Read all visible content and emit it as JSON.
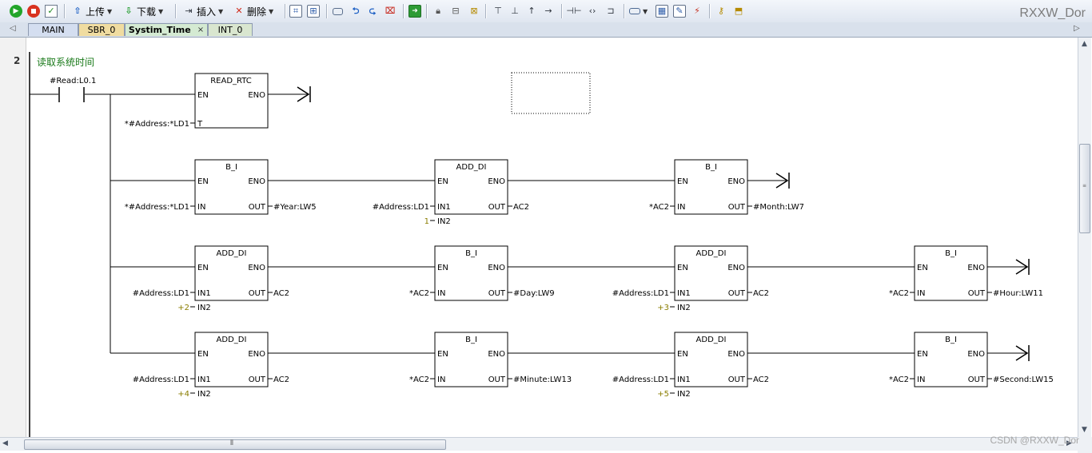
{
  "toolbar": {
    "upload_label": "上传",
    "download_label": "下载",
    "insert_label": "插入",
    "delete_label": "删除",
    "icons": [
      "run-icon",
      "stop-icon",
      "compile-icon",
      "upload-icon",
      "download-icon",
      "insert-icon",
      "delete-icon",
      "network-view-icon",
      "variable-view-icon",
      "box-icon",
      "step-back-icon",
      "step-forward-icon",
      "clear-icon",
      "export-icon",
      "lock-icon",
      "unlock-icon",
      "protect-icon",
      "contact-icons",
      "coil-icons",
      "label-icon",
      "table-icon",
      "edit-icon",
      "debug-icon",
      "key-icon",
      "download-box-icon"
    ]
  },
  "brand": "RXXW_Dor",
  "tabs": [
    {
      "label": "MAIN"
    },
    {
      "label": "SBR_0"
    },
    {
      "label": "Systim_Time",
      "active": true
    },
    {
      "label": "INT_0"
    }
  ],
  "network": {
    "number": "2",
    "title": "读取系统时间",
    "contact_label": "#Read:L0.1",
    "read_rtc": {
      "name": "READ_RTC",
      "en": "EN",
      "eno": "ENO",
      "t_pin": "T",
      "t_operand": "*#Address:*LD1"
    },
    "rows": [
      {
        "blocks": [
          {
            "name": "B_I",
            "in_pins": [
              "IN"
            ],
            "in_ops": [
              "*#Address:*LD1"
            ],
            "out_op": "#Year:LW5"
          },
          {
            "name": "ADD_DI",
            "in_pins": [
              "IN1",
              "IN2"
            ],
            "in_ops": [
              "#Address:LD1",
              "1"
            ],
            "out_op": "AC2"
          },
          {
            "name": "B_I",
            "in_pins": [
              "IN"
            ],
            "in_ops": [
              "*AC2"
            ],
            "out_op": "#Month:LW7"
          }
        ]
      },
      {
        "blocks": [
          {
            "name": "ADD_DI",
            "in_pins": [
              "IN1",
              "IN2"
            ],
            "in_ops": [
              "#Address:LD1",
              "+2"
            ],
            "out_op": "AC2"
          },
          {
            "name": "B_I",
            "in_pins": [
              "IN"
            ],
            "in_ops": [
              "*AC2"
            ],
            "out_op": "#Day:LW9"
          },
          {
            "name": "ADD_DI",
            "in_pins": [
              "IN1",
              "IN2"
            ],
            "in_ops": [
              "#Address:LD1",
              "+3"
            ],
            "out_op": "AC2"
          },
          {
            "name": "B_I",
            "in_pins": [
              "IN"
            ],
            "in_ops": [
              "*AC2"
            ],
            "out_op": "#Hour:LW11"
          }
        ]
      },
      {
        "blocks": [
          {
            "name": "ADD_DI",
            "in_pins": [
              "IN1",
              "IN2"
            ],
            "in_ops": [
              "#Address:LD1",
              "+4"
            ],
            "out_op": "AC2"
          },
          {
            "name": "B_I",
            "in_pins": [
              "IN"
            ],
            "in_ops": [
              "*AC2"
            ],
            "out_op": "#Minute:LW13"
          },
          {
            "name": "ADD_DI",
            "in_pins": [
              "IN1",
              "IN2"
            ],
            "in_ops": [
              "#Address:LD1",
              "+5"
            ],
            "out_op": "AC2"
          },
          {
            "name": "B_I",
            "in_pins": [
              "IN"
            ],
            "in_ops": [
              "*AC2"
            ],
            "out_op": "#Second:LW15"
          }
        ]
      }
    ],
    "pins": {
      "en": "EN",
      "eno": "ENO",
      "out": "OUT"
    }
  },
  "watermark": "CSDN @RXXW_Dor"
}
